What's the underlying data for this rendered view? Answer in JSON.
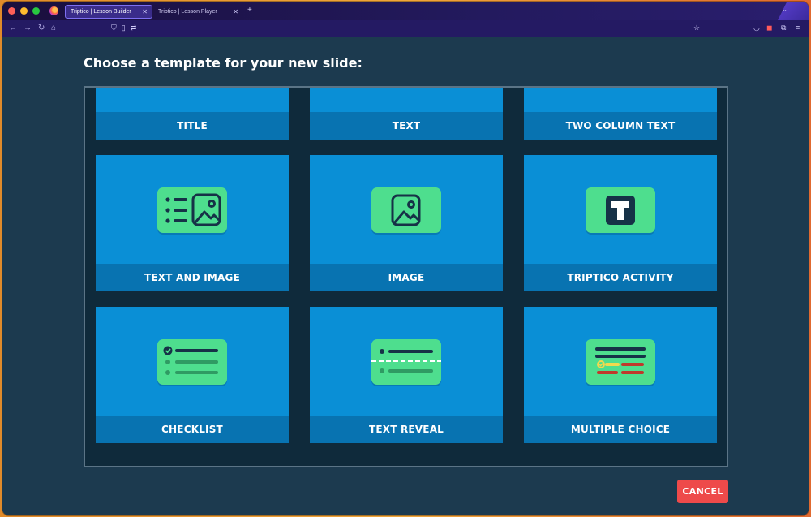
{
  "browser": {
    "tabs": [
      {
        "title": "Triptico | Lesson Builder",
        "active": true
      },
      {
        "title": "Triptico | Lesson Player",
        "active": false
      }
    ]
  },
  "page": {
    "heading": "Choose a template for your new slide:",
    "cancel_label": "CANCEL"
  },
  "templates": [
    {
      "label": "TITLE",
      "icon": "title-icon"
    },
    {
      "label": "TEXT",
      "icon": "text-icon"
    },
    {
      "label": "TWO COLUMN TEXT",
      "icon": "two-column-text-icon"
    },
    {
      "label": "TEXT AND IMAGE",
      "icon": "text-and-image-icon"
    },
    {
      "label": "IMAGE",
      "icon": "image-icon"
    },
    {
      "label": "TRIPTICO ACTIVITY",
      "icon": "triptico-activity-icon"
    },
    {
      "label": "CHECKLIST",
      "icon": "checklist-icon"
    },
    {
      "label": "TEXT REVEAL",
      "icon": "text-reveal-icon"
    },
    {
      "label": "MULTIPLE CHOICE",
      "icon": "multiple-choice-icon"
    }
  ],
  "colors": {
    "background": "#1c3a4f",
    "card": "#0a8fd6",
    "card_label": "#0873b1",
    "icon_green": "#4ede8e",
    "icon_dark": "#163247",
    "cancel": "#ee4a4a"
  }
}
